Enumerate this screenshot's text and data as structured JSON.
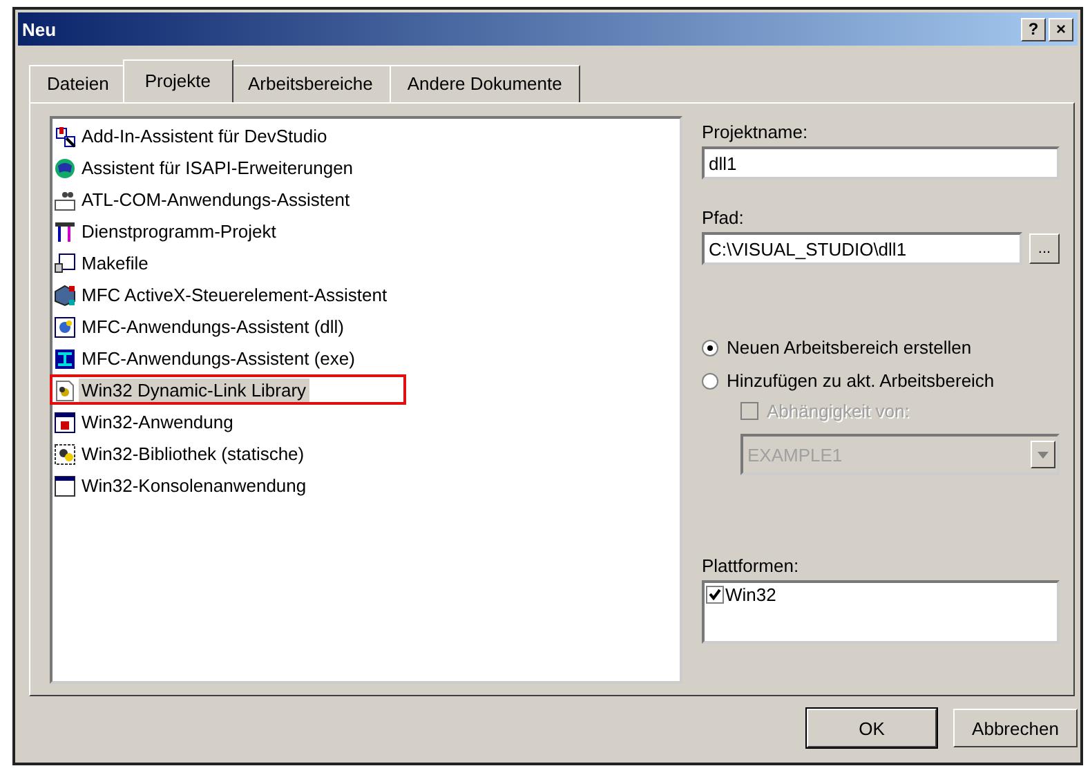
{
  "window": {
    "title": "Neu",
    "help_button": "?",
    "close_button": "×"
  },
  "tabs": [
    {
      "label": "Dateien",
      "selected": false
    },
    {
      "label": "Projekte",
      "selected": true
    },
    {
      "label": "Arbeitsbereiche",
      "selected": false
    },
    {
      "label": "Andere Dokumente",
      "selected": false
    }
  ],
  "project_types": [
    {
      "label": "Add-In-Assistent für DevStudio",
      "selected": false,
      "annotated": false
    },
    {
      "label": "Assistent für ISAPI-Erweiterungen",
      "selected": false,
      "annotated": false
    },
    {
      "label": "ATL-COM-Anwendungs-Assistent",
      "selected": false,
      "annotated": false
    },
    {
      "label": "Dienstprogramm-Projekt",
      "selected": false,
      "annotated": false
    },
    {
      "label": "Makefile",
      "selected": false,
      "annotated": false
    },
    {
      "label": "MFC ActiveX-Steuerelement-Assistent",
      "selected": false,
      "annotated": false
    },
    {
      "label": "MFC-Anwendungs-Assistent (dll)",
      "selected": false,
      "annotated": false
    },
    {
      "label": "MFC-Anwendungs-Assistent (exe)",
      "selected": false,
      "annotated": false
    },
    {
      "label": "Win32 Dynamic-Link Library",
      "selected": true,
      "annotated": true
    },
    {
      "label": "Win32-Anwendung",
      "selected": false,
      "annotated": false
    },
    {
      "label": "Win32-Bibliothek (statische)",
      "selected": false,
      "annotated": false
    },
    {
      "label": "Win32-Konsolenanwendung",
      "selected": false,
      "annotated": false
    }
  ],
  "project_name": {
    "label": "Projektname:",
    "value": "dll1"
  },
  "path": {
    "label": "Pfad:",
    "value": "C:\\VISUAL_STUDIO\\dll1",
    "browse_button": "..."
  },
  "workspace_options": [
    {
      "label": "Neuen Arbeitsbereich erstellen",
      "selected": true
    },
    {
      "label": "Hinzufügen zu akt. Arbeitsbereich",
      "selected": false
    }
  ],
  "dependency": {
    "label": "Abhängigkeit von:",
    "checked": false,
    "disabled": true
  },
  "dependency_project": {
    "value": "EXAMPLE1",
    "disabled": true
  },
  "platforms": {
    "label": "Plattformen:",
    "items": [
      {
        "label": "Win32",
        "checked": true
      }
    ]
  },
  "buttons": [
    {
      "label": "OK",
      "default": true
    },
    {
      "label": "Abbrechen",
      "default": false
    }
  ]
}
